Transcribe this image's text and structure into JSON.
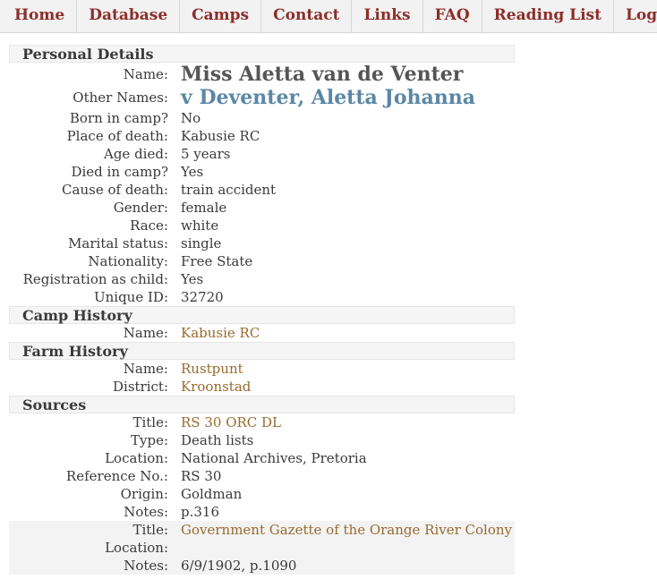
{
  "nav": [
    {
      "label": "Home"
    },
    {
      "label": "Database"
    },
    {
      "label": "Camps"
    },
    {
      "label": "Contact"
    },
    {
      "label": "Links"
    },
    {
      "label": "FAQ"
    },
    {
      "label": "Reading List"
    },
    {
      "label": "Login"
    }
  ],
  "personal": {
    "heading": "Personal Details",
    "name_label": "Name:",
    "name": "Miss Aletta van de Venter",
    "other_names_label": "Other Names:",
    "other_names": "v Deventer, Aletta Johanna",
    "fields": [
      {
        "label": "Born in camp?",
        "value": "No"
      },
      {
        "label": "Place of death:",
        "value": "Kabusie RC"
      },
      {
        "label": "Age died:",
        "value": "5 years"
      },
      {
        "label": "Died in camp?",
        "value": "Yes"
      },
      {
        "label": "Cause of death:",
        "value": "train accident"
      },
      {
        "label": "Gender:",
        "value": "female"
      },
      {
        "label": "Race:",
        "value": "white"
      },
      {
        "label": "Marital status:",
        "value": "single"
      },
      {
        "label": "Nationality:",
        "value": "Free State"
      },
      {
        "label": "Registration as child:",
        "value": "Yes"
      },
      {
        "label": "Unique ID:",
        "value": "32720"
      }
    ]
  },
  "camp": {
    "heading": "Camp History",
    "name_label": "Name:",
    "name": "Kabusie RC"
  },
  "farm": {
    "heading": "Farm History",
    "name_label": "Name:",
    "name": "Rustpunt",
    "district_label": "District:",
    "district": "Kroonstad"
  },
  "sources": {
    "heading": "Sources",
    "s1": {
      "title_label": "Title:",
      "title": "RS 30 ORC DL",
      "type_label": "Type:",
      "type": "Death lists",
      "location_label": "Location:",
      "location": "National Archives, Pretoria",
      "ref_label": "Reference No.:",
      "ref": "RS 30",
      "origin_label": "Origin:",
      "origin": "Goldman",
      "notes_label": "Notes:",
      "notes": "p.316"
    },
    "s2": {
      "title_label": "Title:",
      "title": "Government Gazette of the Orange River Colony",
      "location_label": "Location:",
      "location": "",
      "notes_label": "Notes:",
      "notes": "6/9/1902, p.1090"
    }
  }
}
